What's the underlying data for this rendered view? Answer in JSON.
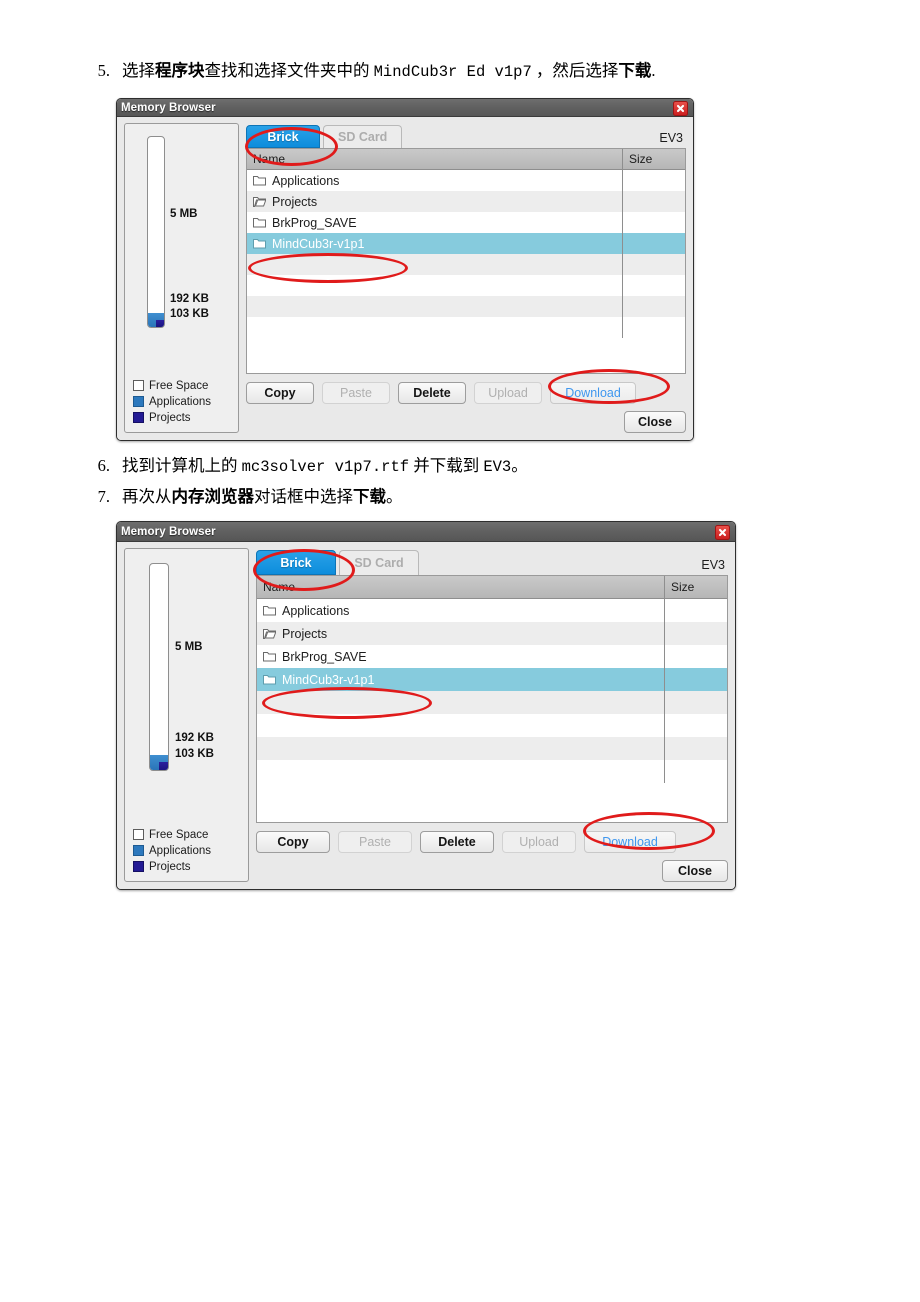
{
  "document": {
    "steps": [
      {
        "number": "5.",
        "segments": [
          {
            "text": "选择",
            "style": "normal"
          },
          {
            "text": "程序块",
            "style": "bold"
          },
          {
            "text": "查找和选择文件夹中的 ",
            "style": "normal"
          },
          {
            "text": "MindCub3r Ed v1p7",
            "style": "mono"
          },
          {
            "text": " ，然后选择",
            "style": "normal"
          },
          {
            "text": "下载",
            "style": "bold"
          },
          {
            "text": ".",
            "style": "normal"
          }
        ],
        "plain": "5. 选择程序块查找和选择文件夹中的 MindCub3r Ed v1p7 ，然后选择下载."
      },
      {
        "number": "6.",
        "segments": [
          {
            "text": "找到计算机上的 ",
            "style": "normal"
          },
          {
            "text": "mc3solver v1p7.rtf",
            "style": "mono"
          },
          {
            "text": " 并下载到 ",
            "style": "normal"
          },
          {
            "text": "EV3",
            "style": "mono"
          },
          {
            "text": "。",
            "style": "normal"
          }
        ],
        "plain": "6. 找到计算机上的 mc3solver v1p7.rtf 并下载到 EV3。"
      },
      {
        "number": "7.",
        "segments": [
          {
            "text": "再次从",
            "style": "normal"
          },
          {
            "text": "内存浏览器",
            "style": "bold"
          },
          {
            "text": "对话框中选择",
            "style": "normal"
          },
          {
            "text": "下载",
            "style": "bold"
          },
          {
            "text": "。",
            "style": "normal"
          }
        ],
        "plain": "7. 再次从内存浏览器对话框中选择下载。"
      }
    ]
  },
  "dialog": {
    "title": "Memory Browser",
    "close_icon": "close-icon",
    "device_label": "EV3",
    "tabs": [
      {
        "label": "Brick",
        "active": true
      },
      {
        "label": "SD Card",
        "active": false
      }
    ],
    "memory": {
      "total_label": "5 MB",
      "free_label": "192 KB",
      "used_label": "103 KB",
      "legend": [
        {
          "label": "Free Space",
          "color": "#ffffff",
          "key": "free"
        },
        {
          "label": "Applications",
          "color": "#2c78bd",
          "key": "apps"
        },
        {
          "label": "Projects",
          "color": "#231a94",
          "key": "proj"
        }
      ]
    },
    "filelist": {
      "columns": [
        "Name",
        "Size"
      ],
      "rows": [
        {
          "name": "Applications",
          "size": "",
          "indent": 1,
          "icon": "folder-closed-icon",
          "selected": false
        },
        {
          "name": "Projects",
          "size": "",
          "indent": 1,
          "icon": "folder-open-icon",
          "selected": false
        },
        {
          "name": "BrkProg_SAVE",
          "size": "",
          "indent": 2,
          "icon": "folder-closed-icon",
          "selected": false
        },
        {
          "name": "MindCub3r-v1p1",
          "size": "",
          "indent": 2,
          "icon": "folder-closed-icon",
          "selected": true
        },
        {
          "name": "",
          "size": "",
          "indent": 0,
          "icon": "",
          "selected": false
        },
        {
          "name": "",
          "size": "",
          "indent": 0,
          "icon": "",
          "selected": false
        },
        {
          "name": "",
          "size": "",
          "indent": 0,
          "icon": "",
          "selected": false
        },
        {
          "name": "",
          "size": "",
          "indent": 0,
          "icon": "",
          "selected": false
        }
      ]
    },
    "buttons": {
      "copy": "Copy",
      "paste": "Paste",
      "delete": "Delete",
      "upload": "Upload",
      "download": "Download",
      "close": "Close"
    },
    "annotation_color": "#e01b1b"
  }
}
